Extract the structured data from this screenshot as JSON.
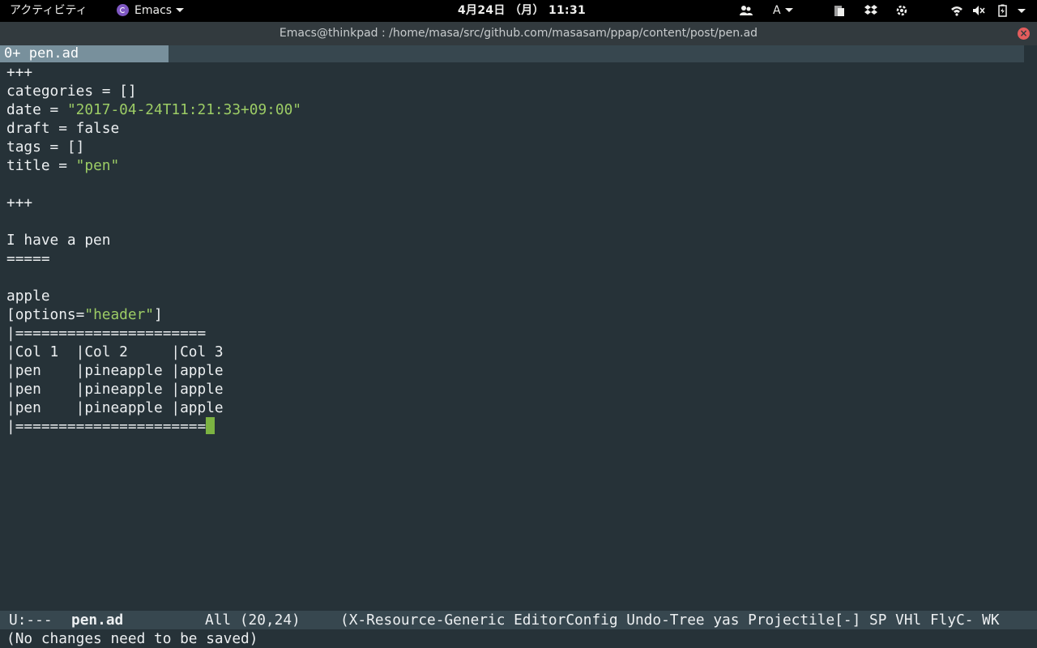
{
  "topbar": {
    "activities": "アクティビティ",
    "app_name": "Emacs",
    "clock": "4月24日 （月） 11:31",
    "input_method": "A",
    "icons": [
      "people-icon",
      "clipboard-icon",
      "dropbox-icon",
      "settings-icon",
      "wifi-icon",
      "volume-muted-icon",
      "battery-icon",
      "system-menu-caret-icon"
    ]
  },
  "window": {
    "title": "Emacs@thinkpad : /home/masa/src/github.com/masasam/ppap/content/post/pen.ad"
  },
  "tabbar": {
    "active_tab": "0+ pen.ad"
  },
  "buffer": {
    "lines": [
      {
        "segments": [
          {
            "text": "+++",
            "style": "default"
          }
        ]
      },
      {
        "segments": [
          {
            "text": "categories = []",
            "style": "default"
          }
        ]
      },
      {
        "segments": [
          {
            "text": "date = ",
            "style": "default"
          },
          {
            "text": "\"2017-04-24T11:21:33+09:00\"",
            "style": "string"
          }
        ]
      },
      {
        "segments": [
          {
            "text": "draft = false",
            "style": "default"
          }
        ]
      },
      {
        "segments": [
          {
            "text": "tags = []",
            "style": "default"
          }
        ]
      },
      {
        "segments": [
          {
            "text": "title = ",
            "style": "default"
          },
          {
            "text": "\"pen\"",
            "style": "string"
          }
        ]
      },
      {
        "segments": [
          {
            "text": "",
            "style": "default"
          }
        ]
      },
      {
        "segments": [
          {
            "text": "+++",
            "style": "default"
          }
        ]
      },
      {
        "segments": [
          {
            "text": "",
            "style": "default"
          }
        ]
      },
      {
        "segments": [
          {
            "text": "I have a pen",
            "style": "default"
          }
        ]
      },
      {
        "segments": [
          {
            "text": "=====",
            "style": "default"
          }
        ]
      },
      {
        "segments": [
          {
            "text": "",
            "style": "default"
          }
        ]
      },
      {
        "segments": [
          {
            "text": "apple",
            "style": "default"
          }
        ]
      },
      {
        "segments": [
          {
            "text": "[options=",
            "style": "default"
          },
          {
            "text": "\"header\"",
            "style": "string"
          },
          {
            "text": "]",
            "style": "default"
          }
        ]
      },
      {
        "segments": [
          {
            "text": "|======================",
            "style": "default"
          }
        ]
      },
      {
        "segments": [
          {
            "text": "|Col 1  |Col 2     |Col 3",
            "style": "default"
          }
        ]
      },
      {
        "segments": [
          {
            "text": "|pen    |pineapple |apple",
            "style": "default"
          }
        ]
      },
      {
        "segments": [
          {
            "text": "|pen    |pineapple |apple",
            "style": "default"
          }
        ]
      },
      {
        "segments": [
          {
            "text": "|pen    |pineapple |apple",
            "style": "default"
          }
        ]
      },
      {
        "segments": [
          {
            "text": "|======================",
            "style": "default"
          }
        ],
        "cursor": true
      }
    ]
  },
  "modeline": {
    "status": "U:---",
    "buffer_name": "pen.ad",
    "position": "All (20,24)",
    "minor_modes": "(X-Resource-Generic EditorConfig Undo-Tree yas Projectile[-] SP VHl FlyC- WK"
  },
  "echo_area": {
    "message": "(No changes need to be saved)"
  },
  "colors": {
    "background": "#263238",
    "string": "#9ccc65",
    "cursor": "#7cb342",
    "tab_active": "#78909c"
  }
}
